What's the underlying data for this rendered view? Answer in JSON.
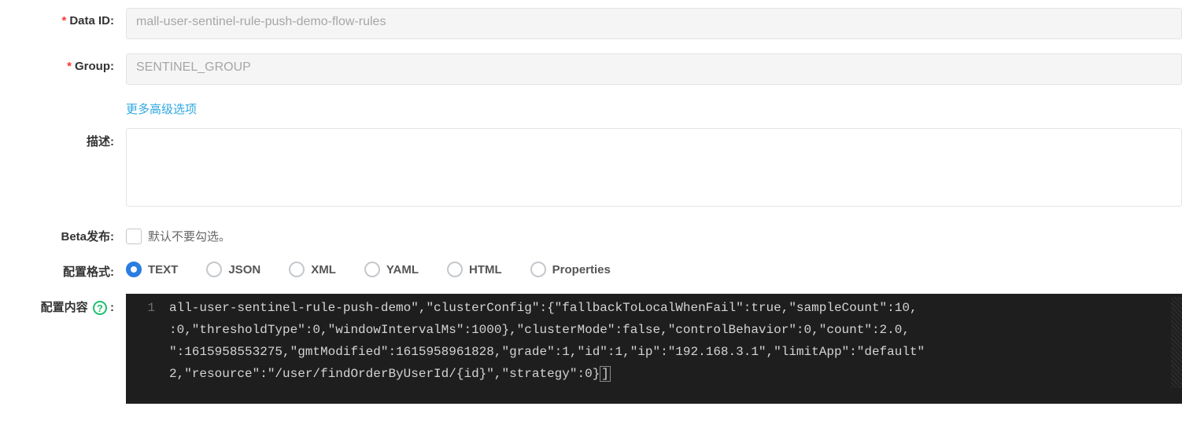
{
  "labels": {
    "data_id": "Data ID:",
    "group": "Group:",
    "advanced": "更多高级选项",
    "description": "描述:",
    "beta": "Beta发布:",
    "beta_hint": "默认不要勾选。",
    "format": "配置格式:",
    "content": "配置内容",
    "help": "?",
    "colon": ":"
  },
  "fields": {
    "data_id_placeholder": "mall-user-sentinel-rule-push-demo-flow-rules",
    "group_placeholder": "SENTINEL_GROUP",
    "description_value": ""
  },
  "formats": [
    "TEXT",
    "JSON",
    "XML",
    "YAML",
    "HTML",
    "Properties"
  ],
  "format_selected": "TEXT",
  "editor": {
    "line_number": "1",
    "line1": "all-user-sentinel-rule-push-demo\",\"clusterConfig\":{\"fallbackToLocalWhenFail\":true,\"sampleCount\":10,",
    "line2": ":0,\"thresholdType\":0,\"windowIntervalMs\":1000},\"clusterMode\":false,\"controlBehavior\":0,\"count\":2.0,",
    "line3": "\":1615958553275,\"gmtModified\":1615958961828,\"grade\":1,\"id\":1,\"ip\":\"192.168.3.1\",\"limitApp\":\"default\"",
    "line4_a": "2,\"resource\":\"/user/findOrderByUserId/{id}\",\"strategy\":0}",
    "line4_b": "]"
  }
}
